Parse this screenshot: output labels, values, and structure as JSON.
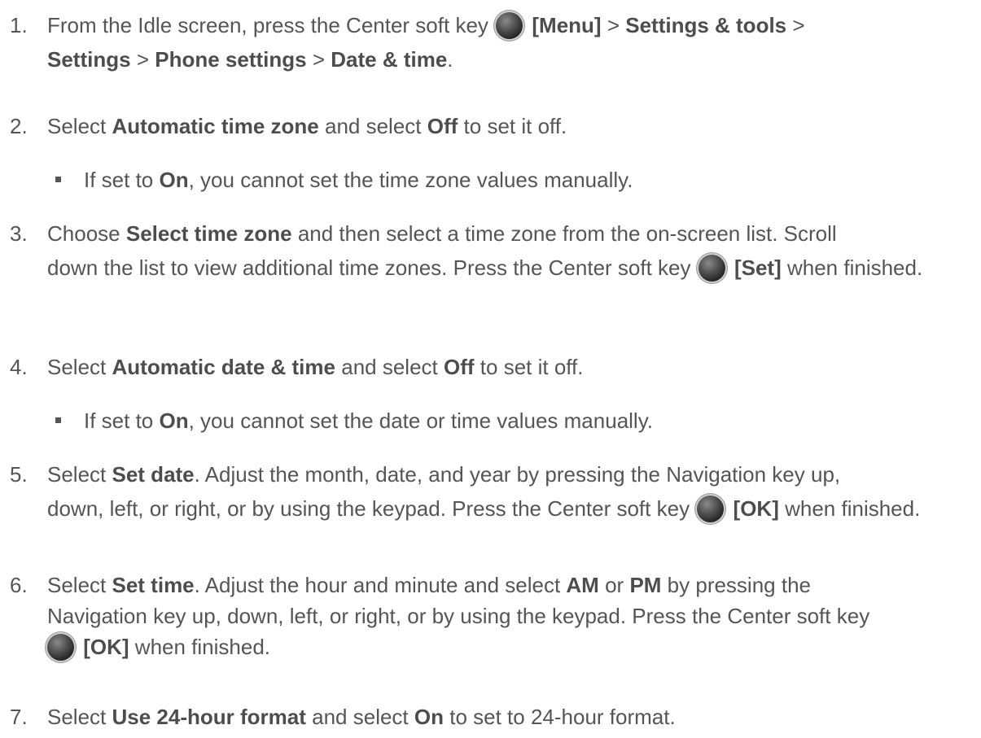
{
  "steps": [
    {
      "num": "1.",
      "parts": [
        "From the Idle screen, press the Center soft key",
        "[Menu]",
        ">",
        "Settings & tools",
        ">",
        "Settings",
        ">",
        "Phone settings",
        ">",
        "Date & time",
        "."
      ]
    },
    {
      "num": "2.",
      "parts": [
        "Select",
        "Automatic time zone",
        "and select",
        "Off",
        "to set it off."
      ]
    },
    {
      "bullet": [
        "If set to",
        "On",
        ", you cannot set the time zone values manually."
      ]
    },
    {
      "num": "3.",
      "parts": [
        "Choose",
        "Select time zone",
        "and then select a time zone from the on-screen list. Scroll down the list to view additional time zones. Press the Center soft key",
        "[Set]",
        "when finished."
      ]
    },
    {
      "num": "4.",
      "parts": [
        "Select",
        "Automatic date & time",
        "and select",
        "Off",
        "to set it off."
      ]
    },
    {
      "bullet": [
        "If set to",
        "On",
        ", you cannot set the date or time values manually."
      ]
    },
    {
      "num": "5.",
      "parts": [
        "Select",
        "Set date",
        ". Adjust the month, date, and year by pressing the Navigation key up, down, left, or right, or by using the keypad. Press the Center soft key",
        "[OK]",
        "when finished."
      ]
    },
    {
      "num": "6.",
      "parts": [
        "Select",
        "Set time",
        ". Adjust the hour and minute and select",
        "AM",
        "or",
        "PM",
        "by pressing the Navigation key up, down, left, or right, or by using the keypad. Press the Center soft key",
        "[OK]",
        "when finished."
      ]
    },
    {
      "num": "7.",
      "parts": [
        "Select",
        "Use 24-hour format",
        "and select",
        "On",
        "to set to 24-hour format."
      ]
    }
  ],
  "icons": {
    "center_key": "center-soft-key-icon"
  }
}
